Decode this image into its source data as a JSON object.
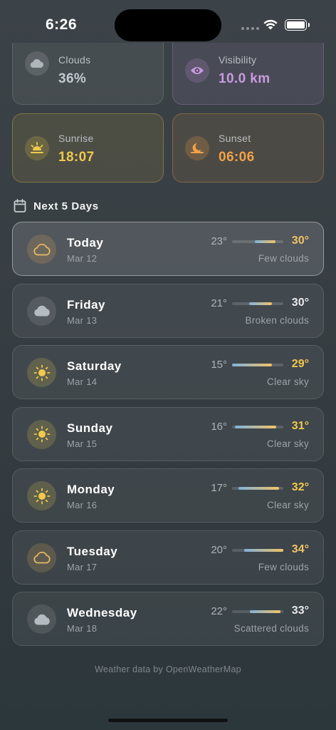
{
  "status": {
    "time": "6:26"
  },
  "tiles": {
    "clouds": {
      "label": "Clouds",
      "value": "36%",
      "color": "#b9c1c7"
    },
    "visibility": {
      "label": "Visibility",
      "value": "10.0 km",
      "color": "#c89ae0"
    },
    "sunrise": {
      "label": "Sunrise",
      "value": "18:07",
      "color": "#f0c94e"
    },
    "sunset": {
      "label": "Sunset",
      "value": "06:06",
      "color": "#f0a24a"
    }
  },
  "forecast": {
    "title": "Next 5 Days",
    "days": [
      {
        "name": "Today",
        "date": "Mar 12",
        "low": "23°",
        "high": "30°",
        "condition": "Few clouds",
        "icon": "cloud-outline-icon",
        "high_color": "#f2c265",
        "range": [
          0.45,
          0.85
        ]
      },
      {
        "name": "Friday",
        "date": "Mar 13",
        "low": "21°",
        "high": "30°",
        "condition": "Broken clouds",
        "icon": "cloud-filled-icon",
        "high_color": "#e6e8ea",
        "range": [
          0.33,
          0.78
        ]
      },
      {
        "name": "Saturday",
        "date": "Mar 14",
        "low": "15°",
        "high": "29°",
        "condition": "Clear sky",
        "icon": "sun-icon",
        "high_color": "#f2c94e",
        "range": [
          0.0,
          0.78
        ]
      },
      {
        "name": "Sunday",
        "date": "Mar 15",
        "low": "16°",
        "high": "31°",
        "condition": "Clear sky",
        "icon": "sun-icon",
        "high_color": "#f2c94e",
        "range": [
          0.06,
          0.86
        ]
      },
      {
        "name": "Monday",
        "date": "Mar 16",
        "low": "17°",
        "high": "32°",
        "condition": "Clear sky",
        "icon": "sun-icon",
        "high_color": "#f2c94e",
        "range": [
          0.12,
          0.92
        ]
      },
      {
        "name": "Tuesday",
        "date": "Mar 17",
        "low": "20°",
        "high": "34°",
        "condition": "Few clouds",
        "icon": "cloud-outline-icon",
        "high_color": "#f2c265",
        "range": [
          0.24,
          1.0
        ]
      },
      {
        "name": "Wednesday",
        "date": "Mar 18",
        "low": "22°",
        "high": "33°",
        "condition": "Scattered clouds",
        "icon": "cloud-filled-icon",
        "high_color": "#e6e8ea",
        "range": [
          0.35,
          0.94
        ]
      }
    ]
  },
  "footer": {
    "credit": "Weather data by OpenWeatherMap"
  }
}
